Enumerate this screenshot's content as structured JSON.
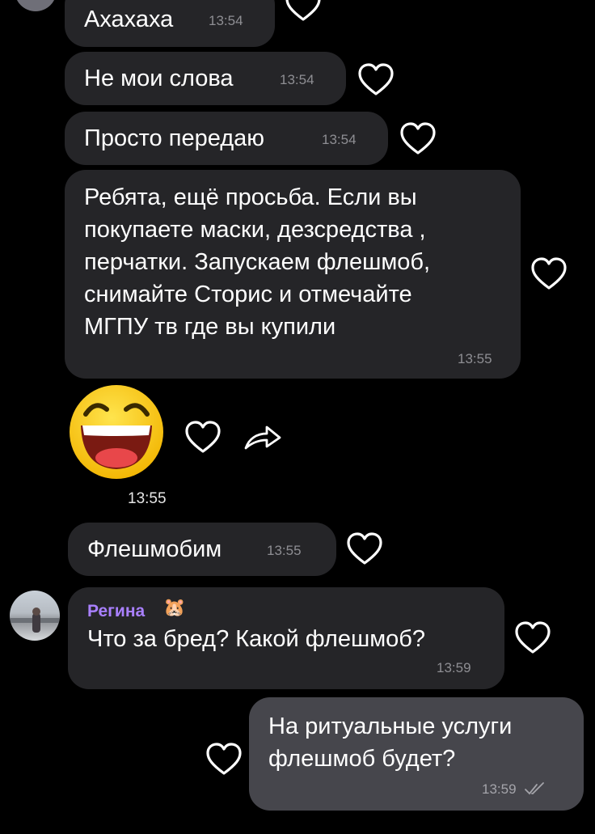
{
  "messages": [
    {
      "id": "m1",
      "text": "Ахахаха",
      "time": "13:54"
    },
    {
      "id": "m2",
      "text": "Не мои слова",
      "time": "13:54"
    },
    {
      "id": "m3",
      "text": "Просто передаю",
      "time": "13:54"
    },
    {
      "id": "m4",
      "lines": [
        "Ребята, ещё просьба. Если вы",
        "покупаете маски, дезсредства ,",
        "перчатки. Запускаем флешмоб,",
        "снимайте Сторис и отмечайте",
        "МГПУ тв где вы купили"
      ],
      "time": "13:55"
    },
    {
      "id": "sticker",
      "time": "13:55",
      "icon": "laughing-face-sticker"
    },
    {
      "id": "m5",
      "text": "Флешмобим",
      "time": "13:55"
    },
    {
      "id": "m6",
      "sender": "Регина",
      "sender_emoji": "🐹",
      "text": "Что за бред? Какой флешмоб?",
      "time": "13:59"
    },
    {
      "id": "m7",
      "lines": [
        "На ритуальные услуги",
        "флешмоб будет?"
      ],
      "time": "13:59",
      "status_icon": "double-check-icon"
    }
  ],
  "colors": {
    "background": "#000000",
    "incoming_bubble": "#252528",
    "outgoing_bubble": "#46464c",
    "sender_name": "#a980ff",
    "time": "#8e8e93"
  }
}
